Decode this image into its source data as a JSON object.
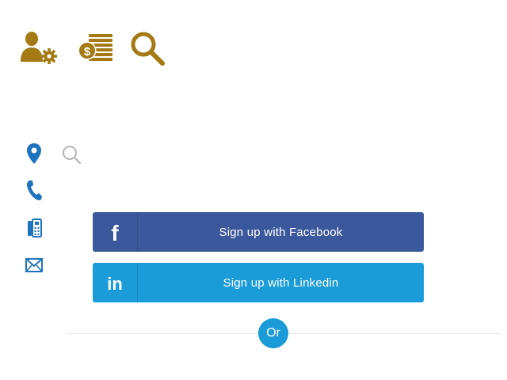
{
  "colors": {
    "gold": "#a37a14",
    "contact_blue": "#1e73be",
    "facebook": "#3a589b",
    "linkedin": "#1b9bd8",
    "divider": "#e3e3e3"
  },
  "top_icons": [
    "user-settings-icon",
    "money-stack-icon",
    "search-icon"
  ],
  "contact_icons": [
    "location-pin-icon",
    "phone-icon",
    "fax-icon",
    "mail-icon"
  ],
  "social": {
    "facebook_label": "Sign up with Facebook",
    "linkedin_label": "Sign up with Linkedin",
    "facebook_glyph": "f",
    "linkedin_glyph": "in"
  },
  "divider": {
    "or_label": "Or"
  }
}
